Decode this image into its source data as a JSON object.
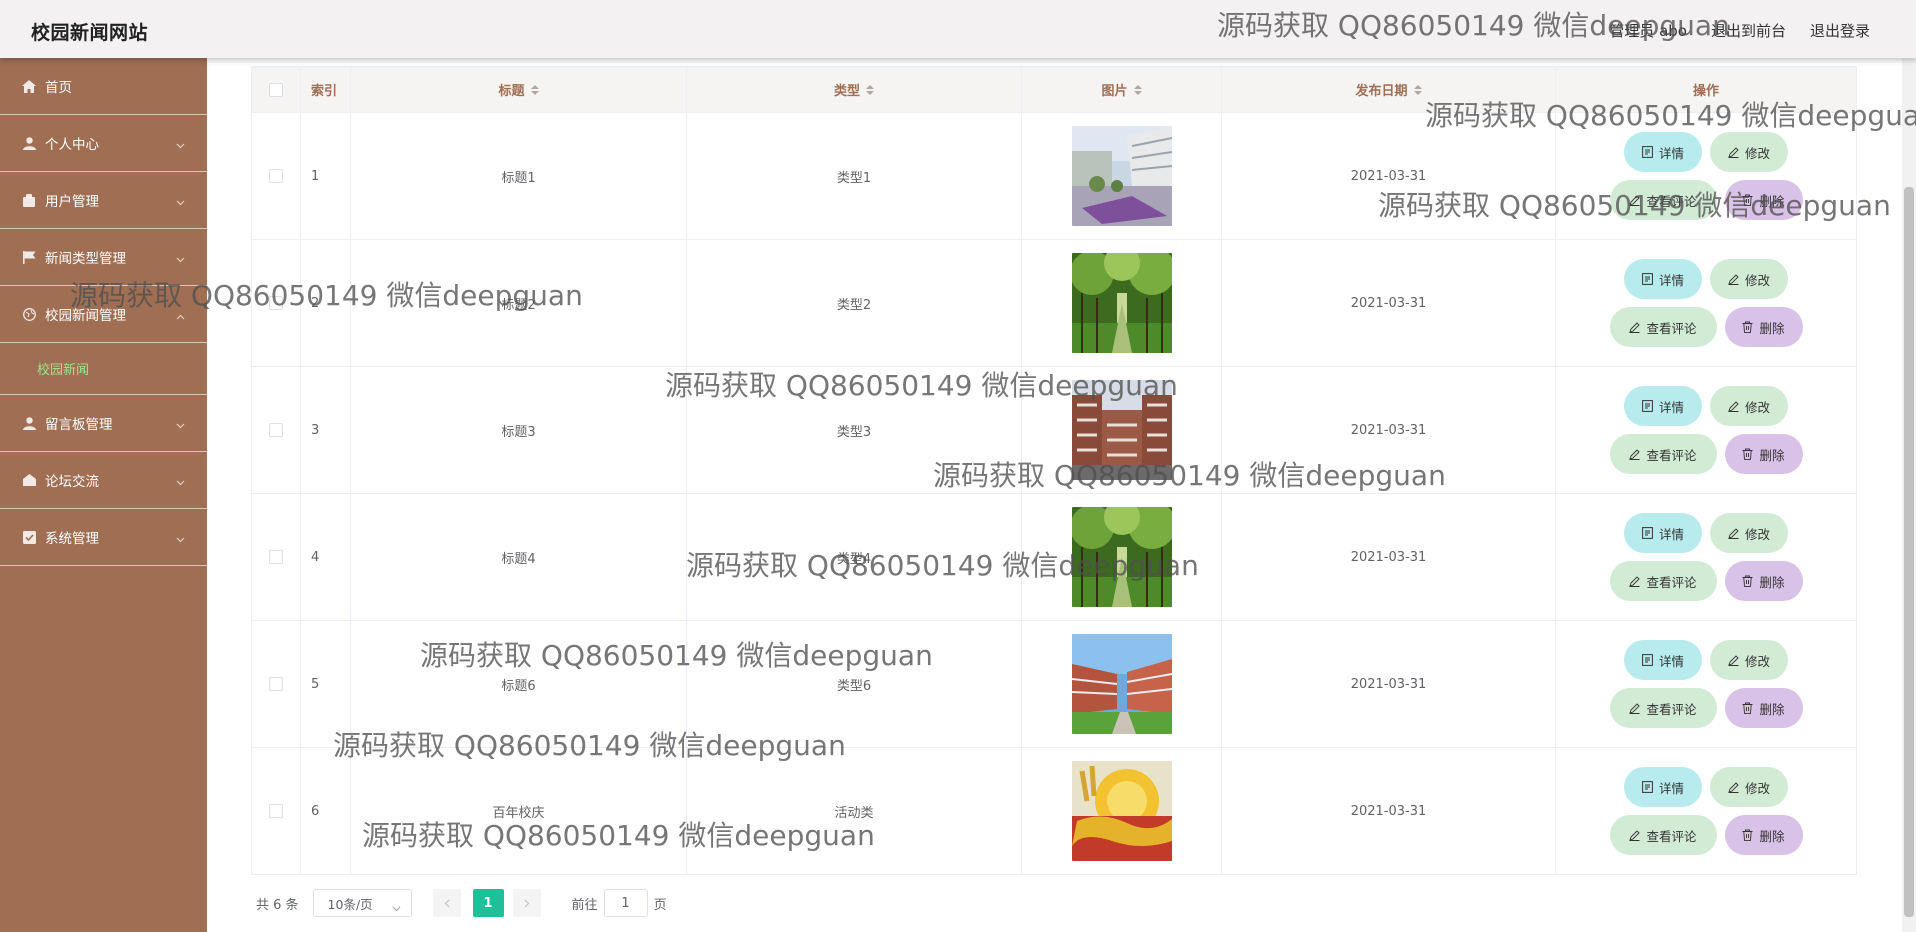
{
  "header": {
    "site_title": "校园新闻网站",
    "user_label": "管理员 abo",
    "back_to_front": "退出到前台",
    "logout": "退出登录"
  },
  "sidebar": {
    "items": [
      {
        "label": "首页",
        "icon": "home-icon",
        "expandable": false
      },
      {
        "label": "个人中心",
        "icon": "user-icon",
        "expandable": true
      },
      {
        "label": "用户管理",
        "icon": "users-icon",
        "expandable": true
      },
      {
        "label": "新闻类型管理",
        "icon": "flag-icon",
        "expandable": true
      },
      {
        "label": "校园新闻管理",
        "icon": "globe-icon",
        "expandable": true,
        "expanded": true
      },
      {
        "label": "留言板管理",
        "icon": "user-icon",
        "expandable": true
      },
      {
        "label": "论坛交流",
        "icon": "chat-icon",
        "expandable": true
      },
      {
        "label": "系统管理",
        "icon": "settings-icon",
        "expandable": true
      }
    ],
    "active_sub": "校园新闻"
  },
  "table": {
    "columns": {
      "index": "索引",
      "title": "标题",
      "type": "类型",
      "image": "图片",
      "date": "发布日期",
      "ops": "操作"
    },
    "rows": [
      {
        "index": "1",
        "title": "标题1",
        "type": "类型1",
        "date": "2021-03-31"
      },
      {
        "index": "2",
        "title": "标题2",
        "type": "类型2",
        "date": "2021-03-31"
      },
      {
        "index": "3",
        "title": "标题3",
        "type": "类型3",
        "date": "2021-03-31"
      },
      {
        "index": "4",
        "title": "标题4",
        "type": "类型4",
        "date": "2021-03-31"
      },
      {
        "index": "5",
        "title": "标题6",
        "type": "类型6",
        "date": "2021-03-31"
      },
      {
        "index": "6",
        "title": "百年校庆",
        "type": "活动类",
        "date": "2021-03-31"
      }
    ],
    "buttons": {
      "detail": "详情",
      "edit": "修改",
      "comments": "查看评论",
      "delete": "删除"
    }
  },
  "pagination": {
    "total": "共 6 条",
    "page_size": "10条/页",
    "current_page": "1",
    "goto_prefix": "前往",
    "goto_value": "1",
    "goto_suffix": "页"
  },
  "watermark": "源码获取 QQ86050149 微信deepguan",
  "colors": {
    "sidebar_bg": "#a06e53",
    "header_bg": "#f3f1f1",
    "active_sub": "#9ee58c",
    "accent_green": "#1fbf9a",
    "btn_detail": "#b7ebee",
    "btn_edit": "#d2ebd5",
    "btn_delete": "#d9c2e7"
  }
}
